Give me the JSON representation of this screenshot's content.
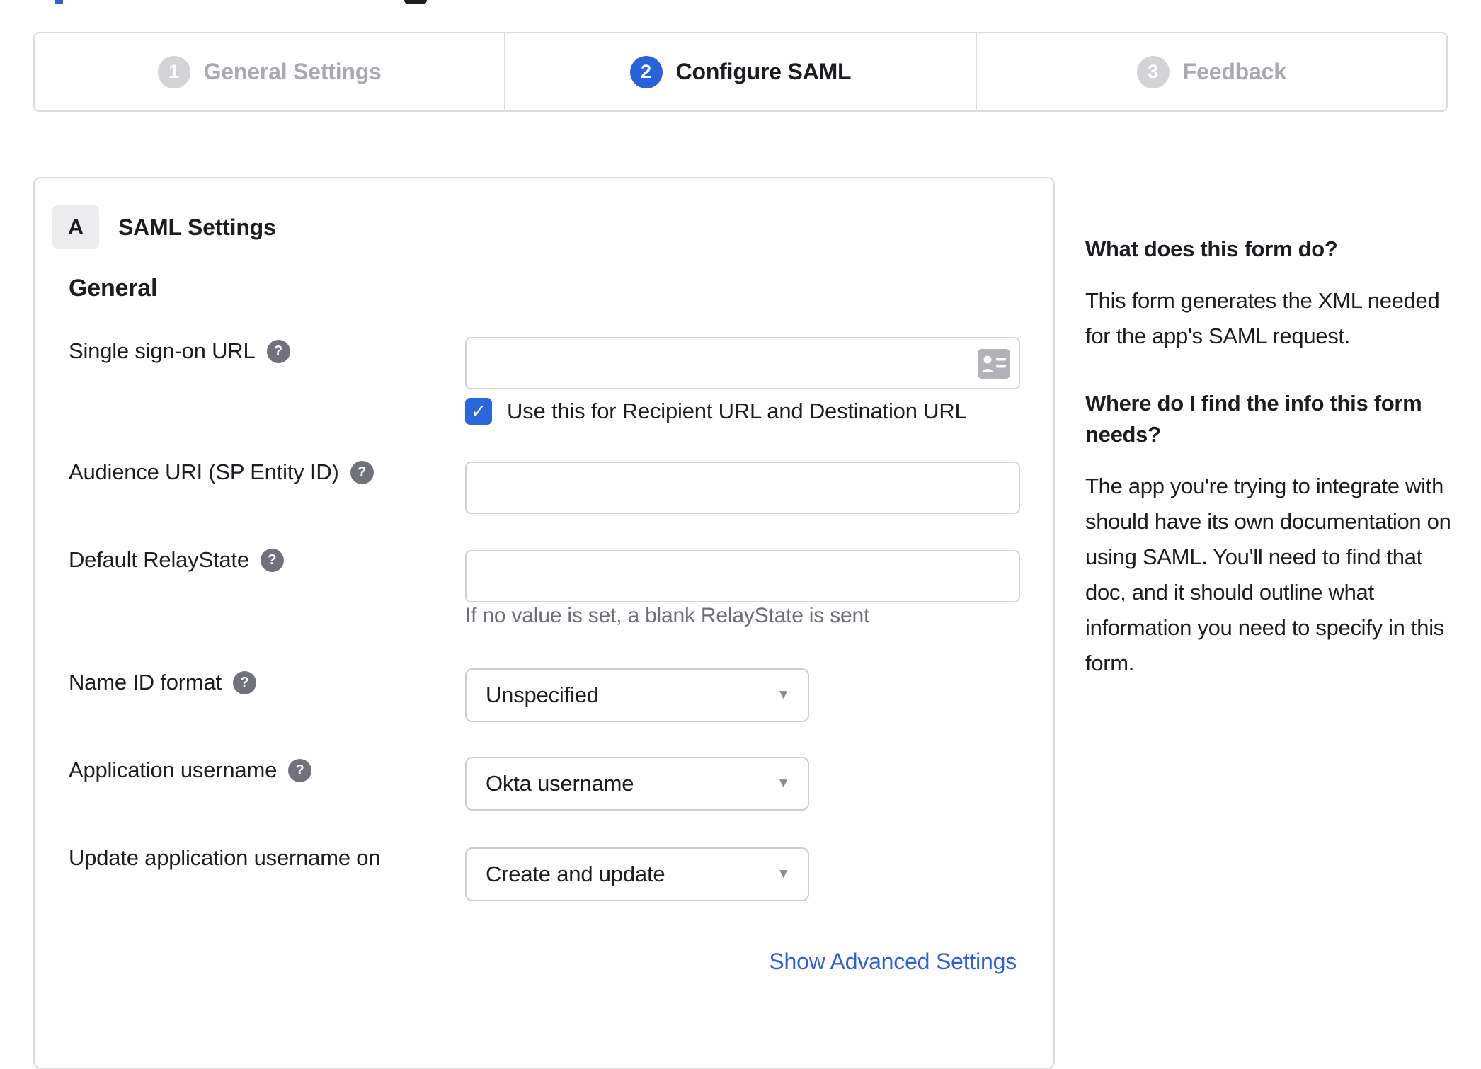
{
  "colors": {
    "accent_blue": "#2a63d9",
    "checkbox_blue": "#2b66dd",
    "link_blue": "#2e5fe0",
    "inactive_grey": "#d4d4d8",
    "border_grey": "#dcdce0",
    "text_dark": "#1d1d21",
    "muted_grey": "#6e6e78"
  },
  "stepper": {
    "steps": [
      {
        "number": "1",
        "label": "General Settings",
        "state": "inactive"
      },
      {
        "number": "2",
        "label": "Configure SAML",
        "state": "active"
      },
      {
        "number": "3",
        "label": "Feedback",
        "state": "inactive"
      }
    ]
  },
  "panel": {
    "badge": "A",
    "title": "SAML Settings",
    "section": "General",
    "fields": [
      {
        "label": "Single sign-on URL",
        "value": "",
        "checkbox_checked": true,
        "checkbox_label": "Use this for Recipient URL and Destination URL"
      },
      {
        "label": "Audience URI (SP Entity ID)",
        "value": ""
      },
      {
        "label": "Default RelayState",
        "value": "",
        "helper": "If no value is set, a blank RelayState is sent"
      },
      {
        "label": "Name ID format",
        "value": "Unspecified"
      },
      {
        "label": "Application username",
        "value": "Okta username"
      },
      {
        "label": "Update application username on",
        "value": "Create and update"
      }
    ],
    "advanced_link": "Show Advanced Settings"
  },
  "sidebar": {
    "heading_1": "What does this form do?",
    "para_1": "This form generates the XML needed for the app's SAML request.",
    "heading_2": "Where do I find the info this form needs?",
    "para_2": "The app you're trying to integrate with should have its own documentation on using SAML. You'll need to find that doc, and it should outline what information you need to specify in this form."
  },
  "icons": {
    "help": "?",
    "check": "✓",
    "caret": "▼"
  }
}
